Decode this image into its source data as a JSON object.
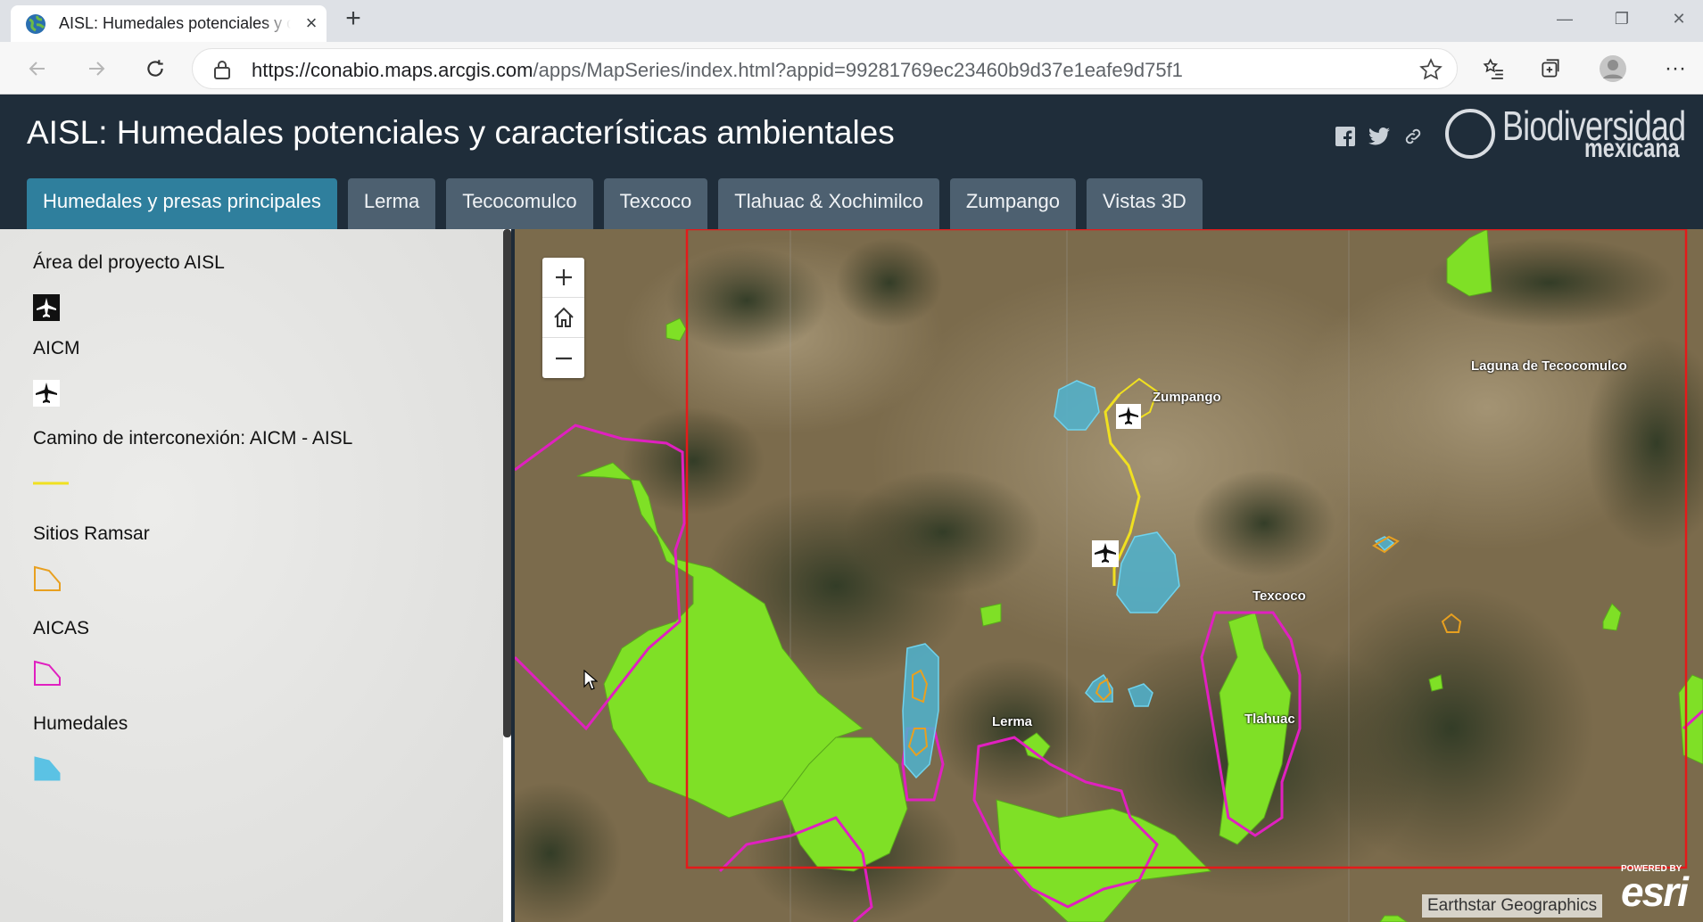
{
  "browser": {
    "tab_title": "AISL: Humedales potenciales y características ambientales",
    "url_host": "https://conabio.maps.arcgis.com",
    "url_path": "/apps/MapSeries/index.html?appid=99281769ec23460b9d37e1eafe9d75f1"
  },
  "header": {
    "title": "AISL: Humedales potenciales y características ambientales",
    "logo_text": "Biodiversidad",
    "logo_subtext": "mexicana"
  },
  "tabs": [
    {
      "label": "Humedales y presas principales",
      "active": true
    },
    {
      "label": "Lerma",
      "active": false
    },
    {
      "label": "Tecocomulco",
      "active": false
    },
    {
      "label": "Texcoco",
      "active": false
    },
    {
      "label": "Tlahuac & Xochimilco",
      "active": false
    },
    {
      "label": "Zumpango",
      "active": false
    },
    {
      "label": "Vistas 3D",
      "active": false
    }
  ],
  "legend": {
    "items": [
      {
        "label": "Área del proyecto AISL",
        "symbol": "airplane-dark-icon"
      },
      {
        "label": "AICM",
        "symbol": "airplane-icon"
      },
      {
        "label": "Camino de interconexión: AICM - AISL",
        "symbol": "line-yellow",
        "color": "#f0e020"
      },
      {
        "label": "Sitios Ramsar",
        "symbol": "polygon-orange",
        "color": "#e8a020"
      },
      {
        "label": "AICAS",
        "symbol": "polygon-magenta",
        "color": "#e020c0"
      },
      {
        "label": "Humedales",
        "symbol": "polygon-blue-fill",
        "color": "#5bc2e4"
      }
    ]
  },
  "map": {
    "labels": {
      "tecocomulco": "Laguna de Tecocomulco",
      "zumpango": "Zumpango",
      "texcoco": "Texcoco",
      "lerma": "Lerma",
      "tlahuac": "Tlahuac"
    },
    "attribution": "Earthstar Geographics",
    "powered_by": "POWERED BY",
    "esri_logo": "esri"
  },
  "colors": {
    "header_bg": "#1f2d3a",
    "tab_active": "#2f7f9d",
    "tab_inactive": "#4d6070",
    "vegetation": "#7fe026",
    "aicas": "#e020c0",
    "study_area": "#e41a1a",
    "wetland": "#4fb3cf"
  }
}
